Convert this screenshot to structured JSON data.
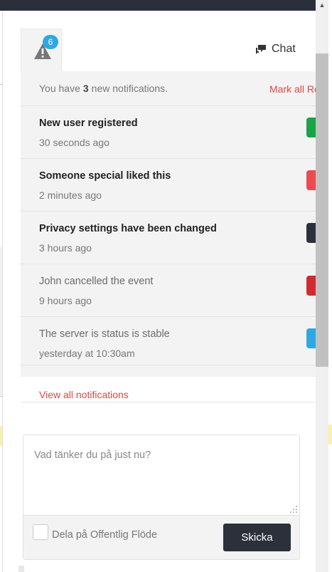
{
  "tabs": {
    "alerts_badge": "6",
    "chat_label": "Chat"
  },
  "notifications": {
    "header_prefix": "You have",
    "header_count": "3",
    "header_suffix": "new notifications.",
    "mark_all_read": "Mark all Re",
    "items": [
      {
        "title": "New user registered",
        "time": "30 seconds ago",
        "color": "#1aa34a"
      },
      {
        "title": "Someone special liked this",
        "time": "2 minutes ago",
        "color": "#ec4b50"
      },
      {
        "title": "Privacy settings have been changed",
        "time": "3 hours ago",
        "color": "#2b303b"
      },
      {
        "title": "John cancelled the event",
        "time": "9 hours ago",
        "color": "#d02b33"
      },
      {
        "title": "The server is status is stable",
        "time": "yesterday at 10:30am",
        "color": "#2ea8e5"
      }
    ],
    "view_all": "View all notifications"
  },
  "composer": {
    "placeholder": "Vad tänker du på just nu?",
    "share_label": "Dela på Offentlig Flöde",
    "send_label": "Skicka"
  }
}
